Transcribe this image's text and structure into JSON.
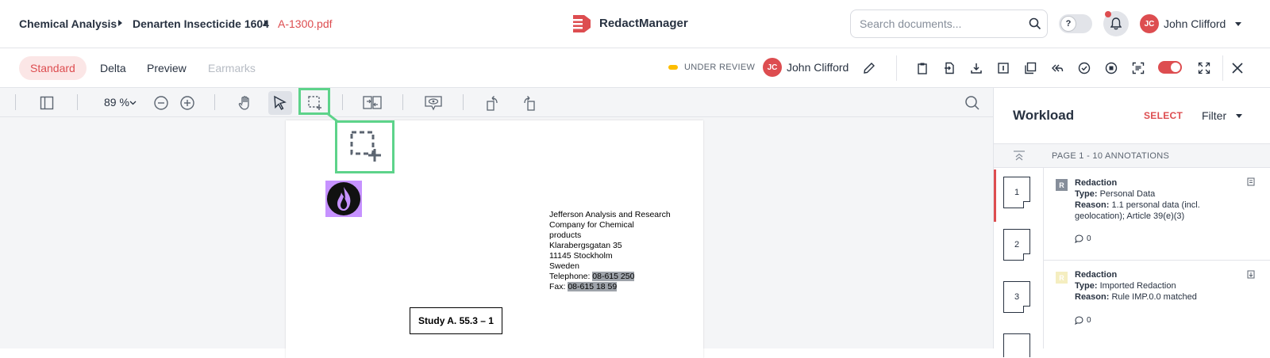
{
  "breadcrumb": {
    "items": [
      "Chemical Analysis",
      "Denarten Insecticide 1604"
    ],
    "current": "A-1300.pdf"
  },
  "brand": {
    "name": "RedactManager",
    "accent": "#dd4d50"
  },
  "search": {
    "placeholder": "Search documents..."
  },
  "help_toggle": {
    "label": "?"
  },
  "user": {
    "initials": "JC",
    "name": "John Clifford"
  },
  "view_tabs": [
    {
      "label": "Standard",
      "state": "active"
    },
    {
      "label": "Delta",
      "state": "normal"
    },
    {
      "label": "Preview",
      "state": "normal"
    },
    {
      "label": "Earmarks",
      "state": "disabled"
    }
  ],
  "document_status": {
    "label": "UNDER REVIEW",
    "color": "#fdbd00"
  },
  "assignee": {
    "initials": "JC",
    "name": "John Clifford"
  },
  "viewer": {
    "zoom": "89 %"
  },
  "document": {
    "address_lines": [
      "Jefferson Analysis and Research",
      "Company for Chemical",
      "products",
      "Klarabergsgatan 35",
      "11145 Stockholm",
      "Sweden"
    ],
    "telephone_label": "Telephone: ",
    "telephone_value": "08-615 250",
    "fax_label": "Fax: ",
    "fax_value": "08-615 18 59",
    "study_title": "Study A. 55.3 – 1"
  },
  "workload": {
    "title": "Workload",
    "select_label": "SELECT",
    "filter_label": "Filter",
    "page_header": "PAGE 1 - 10 ANNOTATIONS",
    "pages": [
      "1",
      "2",
      "3"
    ],
    "annotations": [
      {
        "badge": "R",
        "badge_color": "#868e9a",
        "title": "Redaction",
        "type_label": "Type:",
        "type_value": " Personal Data",
        "reason_label": "Reason:",
        "reason_value": " 1.1 personal data (incl.",
        "reason_value_2": "geolocation); Article 39(e)(3)",
        "comments": "0"
      },
      {
        "badge": "R",
        "badge_color": "#f5eec0",
        "title": "Redaction",
        "type_label": "Type:",
        "type_value": " Imported Redaction",
        "reason_label": "Reason:",
        "reason_value": " Rule IMP.0.0 matched",
        "comments": "0"
      }
    ]
  }
}
